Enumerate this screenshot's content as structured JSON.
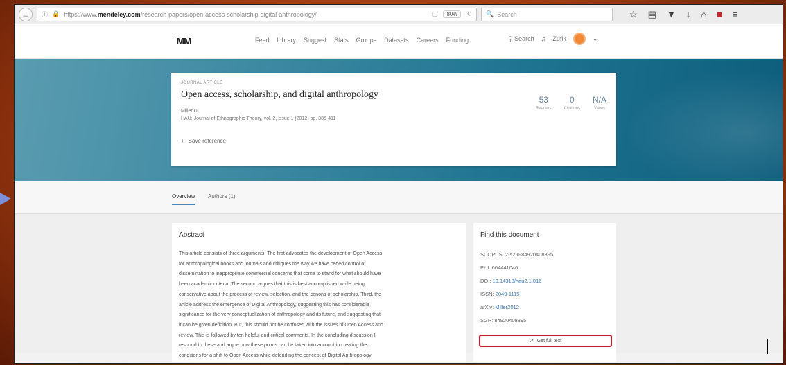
{
  "browser": {
    "url_prefix": "https://www.",
    "url_domain": "mendeley.com",
    "url_path": "/research-papers/open-access-scholarship-digital-anthropology/",
    "zoom": "80%",
    "search_placeholder": "Search"
  },
  "header": {
    "logo": "ᴍᴍ",
    "nav": [
      "Feed",
      "Library",
      "Suggest",
      "Stats",
      "Groups",
      "Datasets",
      "Careers",
      "Funding"
    ],
    "search_label": "Search",
    "user_name": "Zufik"
  },
  "article": {
    "type_label": "JOURNAL ARTICLE",
    "title": "Open access, scholarship, and digital anthropology",
    "authors": "Miller D",
    "journal": "HAU: Journal of Ethnographic Theory, vol. 2, issue 1 (2012) pp. 385-411",
    "save_label": "Save reference",
    "stats": [
      {
        "value": "53",
        "label": "Readers"
      },
      {
        "value": "0",
        "label": "Citations"
      },
      {
        "value": "N/A",
        "label": "Views"
      }
    ]
  },
  "tabs": {
    "overview": "Overview",
    "authors": "Authors (1)"
  },
  "abstract": {
    "heading": "Abstract",
    "lines": [
      "This article consists of three arguments. The first advocates the development of Open Access",
      "for anthropological books and journals and critiques the way we have ceded control of",
      "dissemination to inappropriate commercial concerns that come to stand for what should have",
      "been academic criteria. The second argues that this is best accomplished while being",
      "conservative about the process of review, selection, and the canons of scholarship. Third, the",
      "article address the emergence of Digital Anthropology, suggesting this has considerable",
      "significance for the very conceptualization of anthropology and its future, and suggesting that",
      "it can be given definition. But, this should not be confused with the issues of Open Access and",
      "review. This is followed by ten helpful and critical comments. In the concluding discussion I",
      "respond to these and argue how these points can be taken into account in creating the",
      "conditions for a shift to Open Access while defending the concept of Digital Anthropology"
    ]
  },
  "find": {
    "heading": "Find this document",
    "scopus": "SCOPUS: 2-s2.0-84920408395",
    "pui": "PUI: 604441046",
    "doi_label": "DOI:",
    "doi": "10.14318/hau2.1.016",
    "issn_label": "ISSN:",
    "issn": "2049-1115",
    "arxiv_label": "arXiv:",
    "arxiv": "Miller2012",
    "sgr": "SGR: 84920408395",
    "fulltext_label": "Get full text"
  }
}
